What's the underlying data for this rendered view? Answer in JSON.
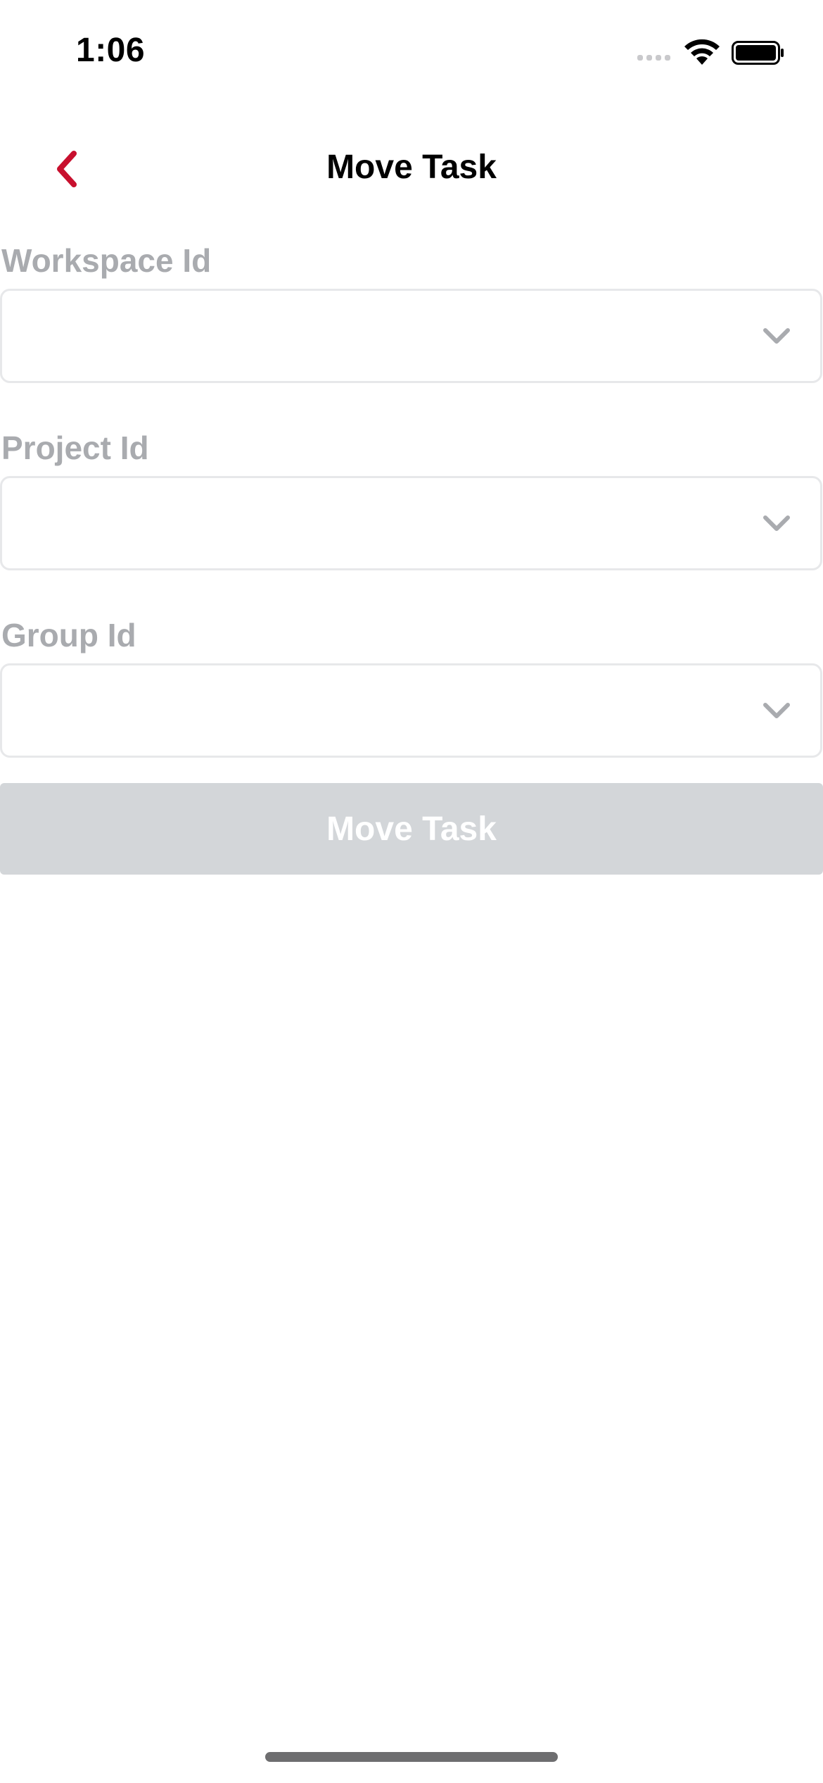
{
  "status_bar": {
    "time": "1:06",
    "signal_icon": "cellular-signal-icon",
    "wifi_icon": "wifi-icon",
    "battery_icon": "battery-icon"
  },
  "nav": {
    "title": "Move Task",
    "back_icon": "chevron-left-icon",
    "accent_color": "#c8102e"
  },
  "form": {
    "fields": [
      {
        "label": "Workspace Id",
        "value": "",
        "placeholder": ""
      },
      {
        "label": "Project Id",
        "value": "",
        "placeholder": ""
      },
      {
        "label": "Group Id",
        "value": "",
        "placeholder": ""
      }
    ],
    "submit_label": "Move Task",
    "submit_enabled": false,
    "label_color": "#a9abaf",
    "disabled_button_color": "#d3d6d9"
  }
}
